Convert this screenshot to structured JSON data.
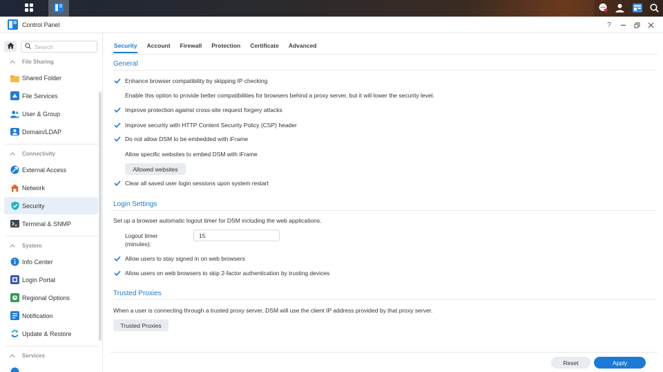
{
  "window": {
    "title": "Control Panel"
  },
  "sidebar": {
    "search_placeholder": "Search",
    "sections": [
      {
        "label": "File Sharing",
        "items": [
          "Shared Folder",
          "File Services",
          "User & Group",
          "Domain/LDAP"
        ]
      },
      {
        "label": "Connectivity",
        "items": [
          "External Access",
          "Network",
          "Security",
          "Terminal & SNMP"
        ]
      },
      {
        "label": "System",
        "items": [
          "Info Center",
          "Login Portal",
          "Regional Options",
          "Notification",
          "Update & Restore"
        ]
      },
      {
        "label": "Services",
        "items": []
      }
    ],
    "active_item": "Security"
  },
  "tabs": [
    "Security",
    "Account",
    "Firewall",
    "Protection",
    "Certificate",
    "Advanced"
  ],
  "active_tab": "Security",
  "general": {
    "title": "General",
    "opt_browser_compat": "Enhance browser compatibility by skipping IP checking",
    "browser_compat_desc": "Enable this option to provide better compatibilities for browsers behind a proxy server, but it will lower the security level.",
    "opt_csrf": "Improve protection against cross-site request forgery attacks",
    "opt_csp": "Improve security with HTTP Content Security Policy (CSP) header",
    "opt_iframe": "Do not allow DSM to be embedded with iFrame",
    "iframe_desc": "Allow specific websites to embed DSM with iFrame",
    "allowed_websites_btn": "Allowed websites",
    "opt_clear_sessions": "Clear all saved user login sessions upon system restart"
  },
  "login": {
    "title": "Login Settings",
    "desc": "Set up a browser automatic logout timer for DSM including the web applications.",
    "logout_label_1": "Logout timer",
    "logout_label_2": "(minutes):",
    "logout_value": "15",
    "opt_stay_signed": "Allow users to stay signed in on web browsers",
    "opt_skip_2fa": "Allow users on web browsers to skip 2-factor authentication by trusting devices"
  },
  "proxies": {
    "title": "Trusted Proxies",
    "desc": "When a user is connecting through a trusted proxy server, DSM will use the client IP address provided by that proxy server.",
    "btn": "Trusted Proxies"
  },
  "footer": {
    "reset": "Reset",
    "apply": "Apply"
  },
  "colors": {
    "accent": "#1a7ad6",
    "active_bg": "#e6eff8"
  }
}
